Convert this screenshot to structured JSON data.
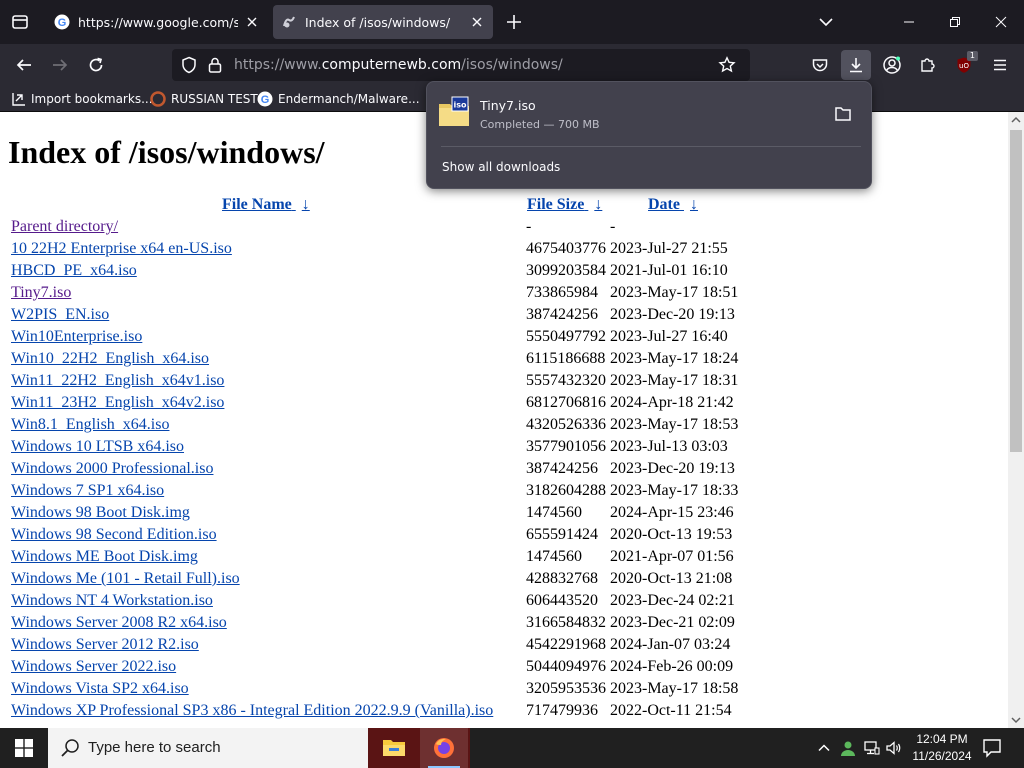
{
  "browser": {
    "tabs": [
      {
        "title": "https://www.google.com/search?q=",
        "active": false
      },
      {
        "title": "Index of /isos/windows/",
        "active": true
      }
    ],
    "url": {
      "prefix": "https://www.",
      "host": "computernewb.com",
      "path": "/isos/windows/"
    },
    "extension_badge": "1",
    "bookmarks": [
      {
        "label": "Import bookmarks..."
      },
      {
        "label": "RUSSIAN TEST"
      },
      {
        "label": "Endermanch/Malware..."
      }
    ]
  },
  "downloads_panel": {
    "file_name": "Tiny7.iso",
    "icon_label": "iso",
    "status": "Completed — 700 MB",
    "show_all_label": "Show all downloads"
  },
  "page": {
    "title": "Index of /isos/windows/",
    "columns": {
      "name": "File Name",
      "size": "File Size",
      "date": "Date",
      "sort_arrow": "↓"
    },
    "rows": [
      {
        "name": "Parent directory/",
        "size": "-",
        "date": "-",
        "visited": true
      },
      {
        "name": "10 22H2 Enterprise x64 en-US.iso",
        "size": "4675403776",
        "date": "2023-Jul-27 21:55",
        "visited": false
      },
      {
        "name": "HBCD_PE_x64.iso",
        "size": "3099203584",
        "date": "2021-Jul-01 16:10",
        "visited": false
      },
      {
        "name": "Tiny7.iso",
        "size": "733865984",
        "date": "2023-May-17 18:51",
        "visited": true
      },
      {
        "name": "W2PIS_EN.iso",
        "size": "387424256",
        "date": "2023-Dec-20 19:13",
        "visited": false
      },
      {
        "name": "Win10Enterprise.iso",
        "size": "5550497792",
        "date": "2023-Jul-27 16:40",
        "visited": false
      },
      {
        "name": "Win10_22H2_English_x64.iso",
        "size": "6115186688",
        "date": "2023-May-17 18:24",
        "visited": false
      },
      {
        "name": "Win11_22H2_English_x64v1.iso",
        "size": "5557432320",
        "date": "2023-May-17 18:31",
        "visited": false
      },
      {
        "name": "Win11_23H2_English_x64v2.iso",
        "size": "6812706816",
        "date": "2024-Apr-18 21:42",
        "visited": false
      },
      {
        "name": "Win8.1_English_x64.iso",
        "size": "4320526336",
        "date": "2023-May-17 18:53",
        "visited": false
      },
      {
        "name": "Windows 10 LTSB x64.iso",
        "size": "3577901056",
        "date": "2023-Jul-13 03:03",
        "visited": false
      },
      {
        "name": "Windows 2000 Professional.iso",
        "size": "387424256",
        "date": "2023-Dec-20 19:13",
        "visited": false
      },
      {
        "name": "Windows 7 SP1 x64.iso",
        "size": "3182604288",
        "date": "2023-May-17 18:33",
        "visited": false
      },
      {
        "name": "Windows 98 Boot Disk.img",
        "size": "1474560",
        "date": "2024-Apr-15 23:46",
        "visited": false
      },
      {
        "name": "Windows 98 Second Edition.iso",
        "size": "655591424",
        "date": "2020-Oct-13 19:53",
        "visited": false
      },
      {
        "name": "Windows ME Boot Disk.img",
        "size": "1474560",
        "date": "2021-Apr-07 01:56",
        "visited": false
      },
      {
        "name": "Windows Me (101 - Retail Full).iso",
        "size": "428832768",
        "date": "2020-Oct-13 21:08",
        "visited": false
      },
      {
        "name": "Windows NT 4 Workstation.iso",
        "size": "606443520",
        "date": "2023-Dec-24 02:21",
        "visited": false
      },
      {
        "name": "Windows Server 2008 R2 x64.iso",
        "size": "3166584832",
        "date": "2023-Dec-21 02:09",
        "visited": false
      },
      {
        "name": "Windows Server 2012 R2.iso",
        "size": "4542291968",
        "date": "2024-Jan-07 03:24",
        "visited": false
      },
      {
        "name": "Windows Server 2022.iso",
        "size": "5044094976",
        "date": "2024-Feb-26 00:09",
        "visited": false
      },
      {
        "name": "Windows Vista SP2 x64.iso",
        "size": "3205953536",
        "date": "2023-May-17 18:58",
        "visited": false
      },
      {
        "name": "Windows XP Professional SP3 x86 - Integral Edition 2022.9.9 (Vanilla).iso",
        "size": "717479936",
        "date": "2022-Oct-11 21:54",
        "visited": false
      }
    ]
  },
  "taskbar": {
    "search_placeholder": "Type here to search",
    "time": "12:04 PM",
    "date": "11/26/2024"
  },
  "colors": {
    "link": "#0645ad",
    "visited": "#551a8b",
    "chrome_bg": "#1c1b22",
    "toolbar_bg": "#2b2a33"
  }
}
